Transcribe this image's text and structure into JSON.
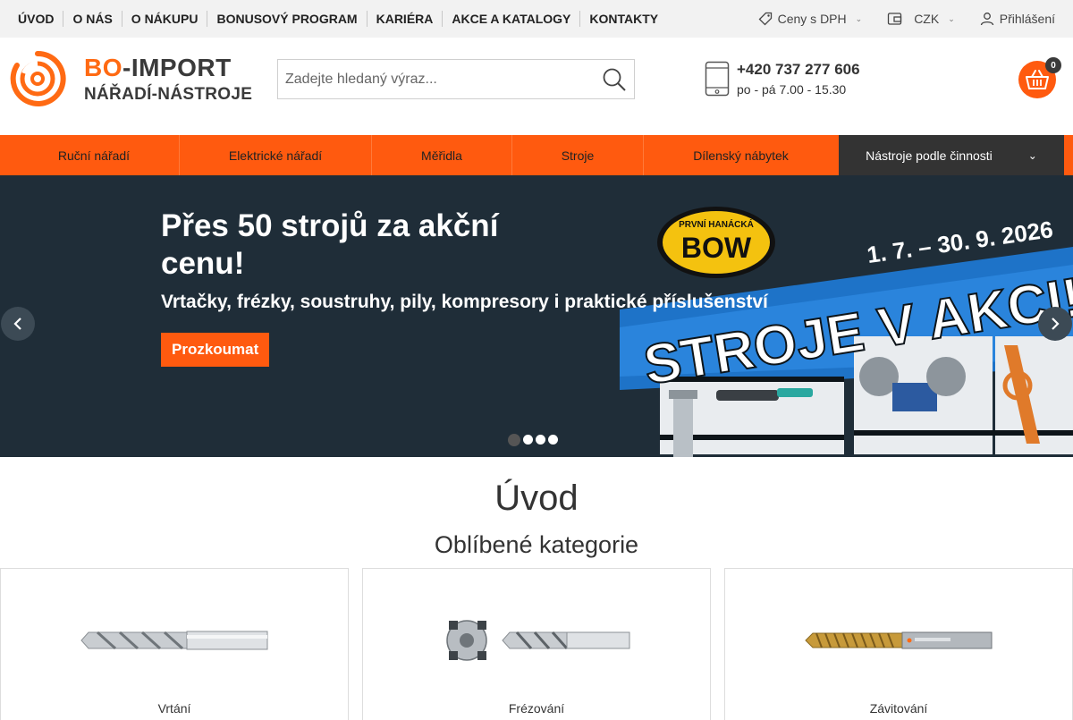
{
  "topnav": {
    "items": [
      "ÚVOD",
      "O NÁS",
      "O NÁKUPU",
      "BONUSOVÝ PROGRAM",
      "KARIÉRA",
      "AKCE A KATALOGY",
      "KONTAKTY"
    ]
  },
  "topright": {
    "prices": "Ceny s DPH",
    "currency": "CZK",
    "login": "Přihlášení"
  },
  "logo": {
    "line1_a": "BO",
    "line1_dash": "-",
    "line1_b": "IMPORT",
    "line2": "NÁŘADÍ-NÁSTROJE"
  },
  "search": {
    "placeholder": "Zadejte hledaný výraz..."
  },
  "contact": {
    "phone": "+420 737 277 606",
    "hours": "po - pá 7.00 - 15.30"
  },
  "cart": {
    "count": "0"
  },
  "categories": [
    "Ruční nářadí",
    "Elektrické nářadí",
    "Měřidla",
    "Stroje",
    "Dílenský nábytek"
  ],
  "categories_dark": "Nástroje podle činnosti",
  "banner": {
    "title": "Přes 50 strojů za akční cenu!",
    "subtitle": "Vrtačky, frézky, soustruhy, pily, kompresory i praktické příslušenství",
    "cta": "Prozkoumat",
    "promo_brand_top": "PRVNÍ HANÁCKÁ",
    "promo_brand": "BOW",
    "promo_dates": "1. 7. – 30. 9. 2026",
    "promo_headline": "STROJE V AKCI!",
    "slides": 4,
    "active_slide": 1
  },
  "page_title": "Úvod",
  "section_title": "Oblíbené kategorie",
  "cards": [
    {
      "label": "Vrtání",
      "icon": "drill-bit-icon"
    },
    {
      "label": "Frézování",
      "icon": "milling-cutter-icon"
    },
    {
      "label": "Závitování",
      "icon": "tap-icon"
    }
  ],
  "colors": {
    "accent": "#ff5a0f",
    "dark": "#333333",
    "banner_bg": "#1f2d38",
    "promo_blue": "#1e73c8"
  }
}
